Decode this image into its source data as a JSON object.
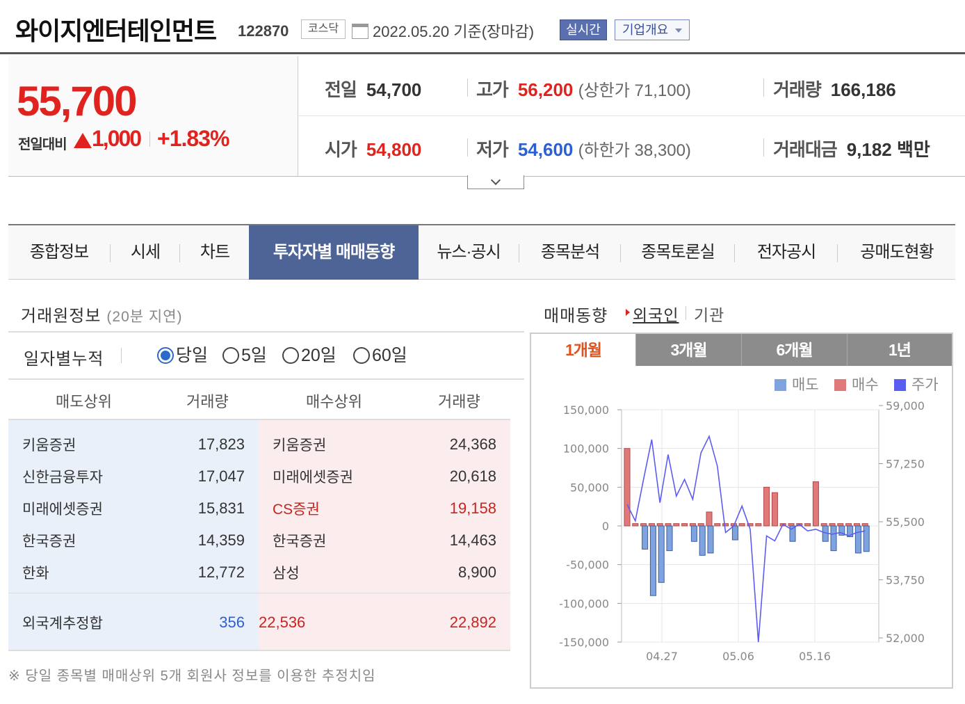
{
  "header": {
    "company": "와이지엔터테인먼트",
    "code": "122870",
    "market": "코스닥",
    "date": "2022.05.20 기준(장마감)",
    "realtime_label": "실시간",
    "overview_label": "기업개요"
  },
  "quote": {
    "price": "55,700",
    "change_label": "전일대비",
    "change": "1,000",
    "change_pct": "+1.83%",
    "prev_label": "전일",
    "prev": "54,700",
    "high_label": "고가",
    "high": "56,200",
    "upper_limit": "(상한가 71,100)",
    "volume_label": "거래량",
    "volume": "166,186",
    "open_label": "시가",
    "open": "54,800",
    "low_label": "저가",
    "low": "54,600",
    "lower_limit": "(하한가 38,300)",
    "amount_label": "거래대금",
    "amount": "9,182 백만"
  },
  "tabs": [
    {
      "label": "종합정보"
    },
    {
      "label": "시세"
    },
    {
      "label": "차트"
    },
    {
      "label": "투자자별 매매동향"
    },
    {
      "label": "뉴스·공시"
    },
    {
      "label": "종목분석"
    },
    {
      "label": "종목토론실"
    },
    {
      "label": "전자공시"
    },
    {
      "label": "공매도현황"
    }
  ],
  "broker": {
    "title": "거래원정보",
    "delay": "(20분 지연)",
    "cum_label": "일자별누적",
    "options": [
      "당일",
      "5일",
      "20일",
      "60일"
    ],
    "selected": "당일",
    "headers": [
      "매도상위",
      "거래량",
      "매수상위",
      "거래량"
    ],
    "rows": [
      {
        "sell_name": "키움증권",
        "sell_vol": "17,823",
        "buy_name": "키움증권",
        "buy_vol": "24,368"
      },
      {
        "sell_name": "신한금융투자",
        "sell_vol": "17,047",
        "buy_name": "미래에셋증권",
        "buy_vol": "20,618"
      },
      {
        "sell_name": "미래에셋증권",
        "sell_vol": "15,831",
        "buy_name": "CS증권",
        "buy_vol": "19,158"
      },
      {
        "sell_name": "한국증권",
        "sell_vol": "14,359",
        "buy_name": "한국증권",
        "buy_vol": "14,463"
      },
      {
        "sell_name": "한화",
        "sell_vol": "12,772",
        "buy_name": "삼성",
        "buy_vol": "8,900"
      }
    ],
    "foreign_label": "외국계추정합",
    "foreign_net": "356",
    "foreign_sell": "22,536",
    "foreign_buy": "22,892",
    "note": "※ 당일 종목별 매매상위 5개 회원사 정보를 이용한 추정치임"
  },
  "trend": {
    "title": "매매동향",
    "selected": "외국인",
    "other": "기관",
    "periods": [
      "1개월",
      "3개월",
      "6개월",
      "1년"
    ],
    "legend": [
      "매도",
      "매수",
      "주가"
    ],
    "colors": {
      "sell": "#7fa3df",
      "buy": "#e07a7a",
      "price": "#5b5cf0"
    }
  },
  "chart_data": {
    "type": "bar",
    "x_ticks": [
      "04.27",
      "05.06",
      "05.16"
    ],
    "y_left_ticks": [
      "150,000",
      "100,000",
      "50,000",
      "0",
      "-50,000",
      "-100,000",
      "-150,000"
    ],
    "y_left_lim": [
      -150000,
      150000
    ],
    "y_right_ticks": [
      "59,000",
      "57,250",
      "55,500",
      "53,750",
      "52,000"
    ],
    "y_right_lim": [
      52000,
      59000
    ],
    "grid": true,
    "series": [
      {
        "name": "매수",
        "values": [
          100000,
          3000,
          3000,
          3000,
          3000,
          3000,
          3000,
          3000,
          3000,
          3000,
          18000,
          3000,
          3000,
          3000,
          3000,
          3000,
          3000,
          50000,
          43000,
          3000,
          3000,
          3000,
          3000,
          57000,
          3000,
          3000,
          3000,
          3000,
          3000,
          3000
        ]
      },
      {
        "name": "매도",
        "values": [
          0,
          0,
          -30000,
          -90000,
          -73000,
          -32000,
          0,
          0,
          -20000,
          -38000,
          -35000,
          0,
          0,
          -18000,
          0,
          0,
          0,
          0,
          0,
          0,
          -20000,
          0,
          0,
          0,
          -20000,
          -32000,
          -12000,
          -14000,
          -35000,
          -33000
        ]
      },
      {
        "name": "주가",
        "values": [
          56150,
          55650,
          56900,
          58100,
          56200,
          57650,
          56400,
          56900,
          56300,
          57700,
          58200,
          57300,
          55300,
          55500,
          56100,
          55400,
          52000,
          55200,
          55050,
          55550,
          55400,
          55550,
          55350,
          55400,
          55300,
          55250,
          55300,
          55200,
          55300,
          55350
        ]
      }
    ]
  }
}
